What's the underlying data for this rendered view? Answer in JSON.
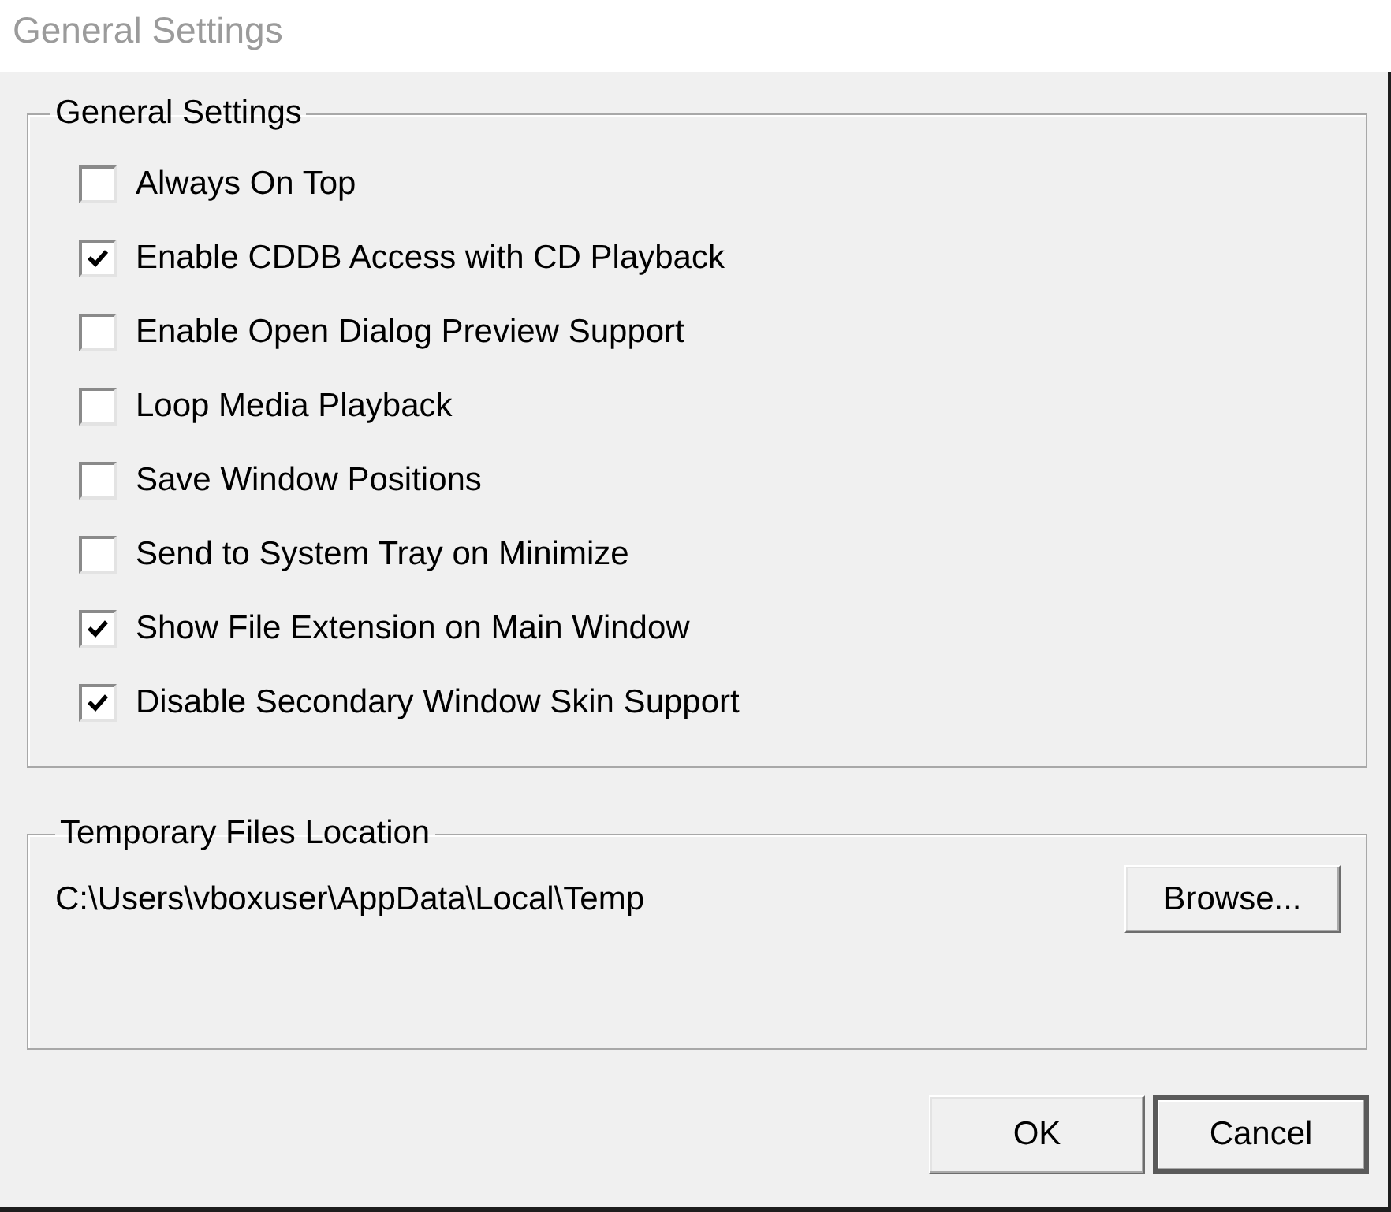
{
  "window": {
    "title": "General Settings"
  },
  "general_settings": {
    "title": "General Settings",
    "options": [
      {
        "label": "Always On Top",
        "checked": false
      },
      {
        "label": "Enable CDDB Access with CD Playback",
        "checked": true
      },
      {
        "label": "Enable Open Dialog Preview Support",
        "checked": false
      },
      {
        "label": "Loop Media Playback",
        "checked": false
      },
      {
        "label": "Save Window Positions",
        "checked": false
      },
      {
        "label": "Send to System Tray on Minimize",
        "checked": false
      },
      {
        "label": "Show File Extension on Main Window",
        "checked": true
      },
      {
        "label": "Disable Secondary Window Skin Support",
        "checked": true
      }
    ]
  },
  "temporary_files": {
    "title": "Temporary Files Location",
    "path": "C:\\Users\\vboxuser\\AppData\\Local\\Temp",
    "browse_button": "Browse..."
  },
  "buttons": [
    {
      "label": "OK",
      "default": false
    },
    {
      "label": "Cancel",
      "default": true
    }
  ]
}
